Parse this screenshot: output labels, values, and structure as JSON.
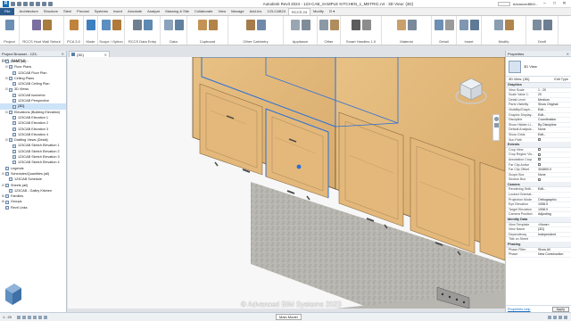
{
  "titlebar": {
    "title": "Autodesk Revit 2024 - 123-CAB_SAMPLE KITCHEN_1_METRIC.rvt - 3D View: {3D}",
    "user": "AdvancedBIM...",
    "min": "–",
    "max": "□",
    "close": "✕"
  },
  "ribbon_tabs": [
    "File",
    "Architecture",
    "Structure",
    "Steel",
    "Precast",
    "Systems",
    "Insert",
    "Annotate",
    "Analyze",
    "Massing & Site",
    "Collaborate",
    "View",
    "Manage",
    "Add-Ins",
    "123-CAB24",
    "RCCS 24",
    "Modify",
    "⊡ ▾"
  ],
  "ribbon_active": "RCCS 24",
  "ribbon_groups": [
    {
      "label": "Project",
      "c1": "#6d8fb3",
      "c2": "#4f6d91"
    },
    {
      "label": "RCCS Hoot Wall Setout",
      "c1": "#7a6f9f",
      "c2": "#a87b3e"
    },
    {
      "label": "PCA 3.0",
      "c1": "#c0833e",
      "c2": "#8a8a8a"
    },
    {
      "label": "Mode",
      "c1": "#3e7fbf",
      "c2": "#6a6a6a"
    },
    {
      "label": "Scope / Option",
      "c1": "#5a8fc0",
      "c2": "#b07a3a"
    },
    {
      "label": "RCCS Data Entry",
      "c1": "#6f7f8f",
      "c2": "#5e89b2"
    },
    {
      "label": "Data",
      "c1": "#8aa2bc",
      "c2": "#61809f"
    },
    {
      "label": "Cupboard",
      "c1": "#c39355",
      "c2": "#b3844a"
    },
    {
      "label": "Other Cabinetry",
      "c1": "#a57c4a",
      "c2": "#6f8aa8"
    },
    {
      "label": "Appliance",
      "c1": "#9aa7b3",
      "c2": "#7f8d99"
    },
    {
      "label": "Other",
      "c1": "#8b99a6",
      "c2": "#b08d5c"
    },
    {
      "label": "Smart Handles 1.0",
      "c1": "#5c5c5c",
      "c2": "#8c8c8c"
    },
    {
      "label": "Material",
      "c1": "#c9a06a",
      "c2": "#7a8a9a"
    },
    {
      "label": "Detail",
      "c1": "#6d8fb3",
      "c2": "#9a9a9a"
    },
    {
      "label": "Insert",
      "c1": "#7f97b0",
      "c2": "#5f7a96"
    },
    {
      "label": "Modify",
      "c1": "#8a9db1",
      "c2": "#b0844c"
    },
    {
      "label": "Draft",
      "c1": "#7b8c9d",
      "c2": "#6c7e91"
    }
  ],
  "view_tab": {
    "label": "{3D}",
    "close": "✕"
  },
  "project_browser": {
    "title": "Project Browser - 123-CAB_SAMPLE...",
    "close": "✕",
    "nodes": [
      {
        "indent": 0,
        "toggle": "⊟",
        "label": "Views (all)",
        "selected": false
      },
      {
        "indent": 1,
        "toggle": "⊟",
        "label": "Floor Plans",
        "selected": false
      },
      {
        "indent": 2,
        "toggle": "",
        "label": "123CAB Floor Plan",
        "selected": false
      },
      {
        "indent": 1,
        "toggle": "⊟",
        "label": "Ceiling Plans",
        "selected": false
      },
      {
        "indent": 2,
        "toggle": "",
        "label": "123CAB Ceiling Plan",
        "selected": false
      },
      {
        "indent": 1,
        "toggle": "⊟",
        "label": "3D Views",
        "selected": false
      },
      {
        "indent": 2,
        "toggle": "",
        "label": "123CAB Isometric",
        "selected": false
      },
      {
        "indent": 2,
        "toggle": "",
        "label": "123CAB Perspective",
        "selected": false
      },
      {
        "indent": 2,
        "toggle": "",
        "label": "{3D}",
        "selected": true
      },
      {
        "indent": 1,
        "toggle": "⊟",
        "label": "Elevations (Building Elevation)",
        "selected": false
      },
      {
        "indent": 2,
        "toggle": "",
        "label": "123CAB Elevation 1",
        "selected": false
      },
      {
        "indent": 2,
        "toggle": "",
        "label": "123CAB Elevation 2",
        "selected": false
      },
      {
        "indent": 2,
        "toggle": "",
        "label": "123CAB Elevation 3",
        "selected": false
      },
      {
        "indent": 2,
        "toggle": "",
        "label": "123CAB Elevation 4",
        "selected": false
      },
      {
        "indent": 1,
        "toggle": "⊟",
        "label": "Drafting Views (Detail)",
        "selected": false
      },
      {
        "indent": 2,
        "toggle": "",
        "label": "123CAB Sketch Elevation 1",
        "selected": false
      },
      {
        "indent": 2,
        "toggle": "",
        "label": "123CAB Sketch Elevation 2",
        "selected": false
      },
      {
        "indent": 2,
        "toggle": "",
        "label": "123CAB Sketch Elevation 3",
        "selected": false
      },
      {
        "indent": 2,
        "toggle": "",
        "label": "123CAB Sketch Elevation 4",
        "selected": false
      },
      {
        "indent": 0,
        "toggle": "",
        "label": "Legends",
        "selected": false
      },
      {
        "indent": 0,
        "toggle": "⊟",
        "label": "Schedules/Quantities (all)",
        "selected": false
      },
      {
        "indent": 1,
        "toggle": "",
        "label": "123CAB Schedule",
        "selected": false
      },
      {
        "indent": 0,
        "toggle": "⊟",
        "label": "Sheets (all)",
        "selected": false
      },
      {
        "indent": 1,
        "toggle": "",
        "label": "123CAB - Galley Kitchen",
        "selected": false
      },
      {
        "indent": 0,
        "toggle": "⊞",
        "label": "Families",
        "selected": false
      },
      {
        "indent": 0,
        "toggle": "⊞",
        "label": "Groups",
        "selected": false
      },
      {
        "indent": 0,
        "toggle": "",
        "label": "Revit Links",
        "selected": false
      }
    ]
  },
  "watermark": "© Advanced BIM Systems 2023",
  "properties": {
    "title": "Properties",
    "close": "✕",
    "type": "3D View",
    "select_label": "3D View: {3D}",
    "edit_type": "Edit Type",
    "sections": [
      {
        "name": "Graphics",
        "rows": [
          [
            "View Scale",
            "1 : 20"
          ],
          [
            "Scale Value 1:",
            "20"
          ],
          [
            "Detail Level",
            "Medium"
          ],
          [
            "Parts Visibility",
            "Show Original"
          ],
          [
            "Visibility/Graph...",
            "Edit..."
          ],
          [
            "Graphic Display...",
            "Edit..."
          ],
          [
            "Discipline",
            "Coordination"
          ],
          [
            "Show Hidden Li...",
            "By Discipline"
          ],
          [
            "Default Analysis...",
            "None"
          ],
          [
            "Show Grids",
            "Edit..."
          ],
          [
            "Sun Path",
            "cb"
          ]
        ]
      },
      {
        "name": "Extents",
        "rows": [
          [
            "Crop View",
            "cb"
          ],
          [
            "Crop Region Vis...",
            "cb"
          ],
          [
            "Annotation Crop",
            "cb"
          ],
          [
            "Far Clip Active",
            "cb"
          ],
          [
            "Far Clip Offset",
            "304800.0"
          ],
          [
            "Scope Box",
            "None"
          ],
          [
            "Section Box",
            "cb"
          ]
        ]
      },
      {
        "name": "Camera",
        "rows": [
          [
            "Rendering Setti...",
            "Edit..."
          ],
          [
            "Locked Orientat...",
            ""
          ],
          [
            "Projection Mode",
            "Orthographic"
          ],
          [
            "Eye Elevation",
            "1058.9"
          ],
          [
            "Target Elevation",
            "1058.9"
          ],
          [
            "Camera Position",
            "Adjusting"
          ]
        ]
      },
      {
        "name": "Identity Data",
        "rows": [
          [
            "View Template",
            "<None>"
          ],
          [
            "View Name",
            "{3D}"
          ],
          [
            "Dependency",
            "Independent"
          ],
          [
            "Title on Sheet",
            ""
          ]
        ]
      },
      {
        "name": "Phasing",
        "rows": [
          [
            "Phase Filter",
            "Show All"
          ],
          [
            "Phase",
            "New Construction"
          ]
        ]
      }
    ],
    "help": "Properties help",
    "apply": "Apply"
  },
  "statusbar": {
    "scale": "1 : 20",
    "main_model": "Main Model"
  },
  "colors": {
    "door_wood": "#e0b678",
    "door_wood_dark": "#c9995a",
    "backsplash": "#b5b3ad",
    "selection": "#2a6fd8",
    "handle": "#4a4a4a"
  }
}
